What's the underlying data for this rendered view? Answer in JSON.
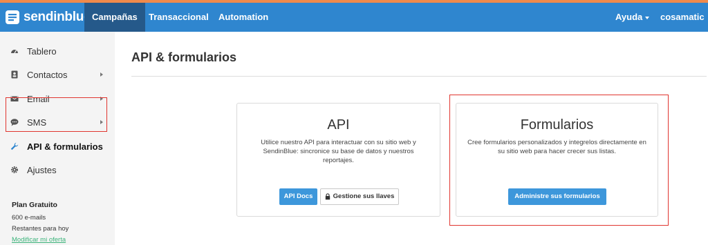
{
  "brand": {
    "name": "sendinblue"
  },
  "topnav": {
    "tabs": [
      {
        "label": "Campañas",
        "active": true
      },
      {
        "label": "Transaccional",
        "active": false
      },
      {
        "label": "Automation",
        "active": false
      }
    ],
    "help_label": "Ayuda",
    "account_label": "cosamatic"
  },
  "sidebar": {
    "items": [
      {
        "label": "Tablero",
        "icon": "dashboard-icon",
        "has_submenu": false
      },
      {
        "label": "Contactos",
        "icon": "contacts-icon",
        "has_submenu": true
      },
      {
        "label": "Email",
        "icon": "envelope-icon",
        "has_submenu": true
      },
      {
        "label": "SMS",
        "icon": "chat-icon",
        "has_submenu": true
      },
      {
        "label": "API & formularios",
        "icon": "wrench-icon",
        "has_submenu": false,
        "active": true
      },
      {
        "label": "Ajustes",
        "icon": "gear-icon",
        "has_submenu": false
      }
    ],
    "plan": {
      "title": "Plan Gratuito",
      "emails": "600 e-mails",
      "remaining": "Restantes para hoy",
      "link": "Modificar mi oferta"
    }
  },
  "main": {
    "title": "API & formularios",
    "cards": {
      "api": {
        "title": "API",
        "description_line1": "Utilice nuestro API para interactuar con su sitio web y",
        "description_line2": "SendinBlue: sincronice su base de datos y nuestros",
        "description_line3": "reportajes.",
        "docs_button": "API Docs",
        "keys_button": "Gestione sus llaves"
      },
      "forms": {
        "title": "Formularios",
        "description_line1": "Cree formularios personalizados y integrelos directamente en",
        "description_line2": "su sitio web para hacer crecer sus listas.",
        "manage_button": "Administre sus formularios"
      }
    }
  },
  "colors": {
    "navbar": "#2f86cf",
    "active_tab": "#25598a",
    "top_stripe": "#f08a4b",
    "button_blue": "#3d97db",
    "highlight": "#e0342e",
    "plan_link": "#3bb37a"
  }
}
